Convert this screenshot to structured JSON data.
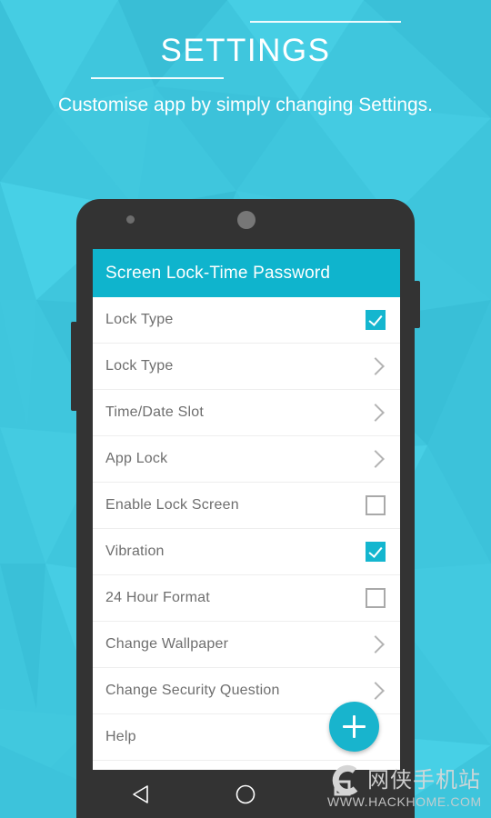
{
  "page": {
    "background_color": "#3fc6dd",
    "accent_color": "#0fb4cd"
  },
  "header": {
    "title": "SETTINGS",
    "subtitle": "Customise app by simply changing Settings."
  },
  "phone": {
    "camera_icon": "camera-dot-icon",
    "speaker_icon": "speaker-circle-icon",
    "volume_button": "volume-rocker",
    "power_button": "power-button"
  },
  "app": {
    "appbar": {
      "title": "Screen Lock-Time Password",
      "color": "#0fb4cd"
    },
    "rows": [
      {
        "label": "Lock Type",
        "control": "checkbox",
        "checked": true
      },
      {
        "label": "Lock Type",
        "control": "chevron",
        "checked": false
      },
      {
        "label": "Time/Date Slot",
        "control": "chevron",
        "checked": false
      },
      {
        "label": "App Lock",
        "control": "chevron",
        "checked": false
      },
      {
        "label": "Enable Lock Screen",
        "control": "checkbox",
        "checked": false
      },
      {
        "label": "Vibration",
        "control": "checkbox",
        "checked": true
      },
      {
        "label": "24 Hour Format",
        "control": "checkbox",
        "checked": false
      },
      {
        "label": "Change Wallpaper",
        "control": "chevron",
        "checked": false
      },
      {
        "label": "Change Security Question",
        "control": "chevron",
        "checked": false
      },
      {
        "label": "Help",
        "control": "none",
        "checked": false
      }
    ],
    "fab": {
      "icon": "plus-icon",
      "color": "#18b4cd"
    }
  },
  "navbar": {
    "back_icon": "back-triangle-icon",
    "home_icon": "home-circle-icon"
  },
  "watermark": {
    "logo_icon": "hackhome-logo-icon",
    "site_name": "网侠手机站",
    "url": "WWW.HACKHOME.COM"
  }
}
